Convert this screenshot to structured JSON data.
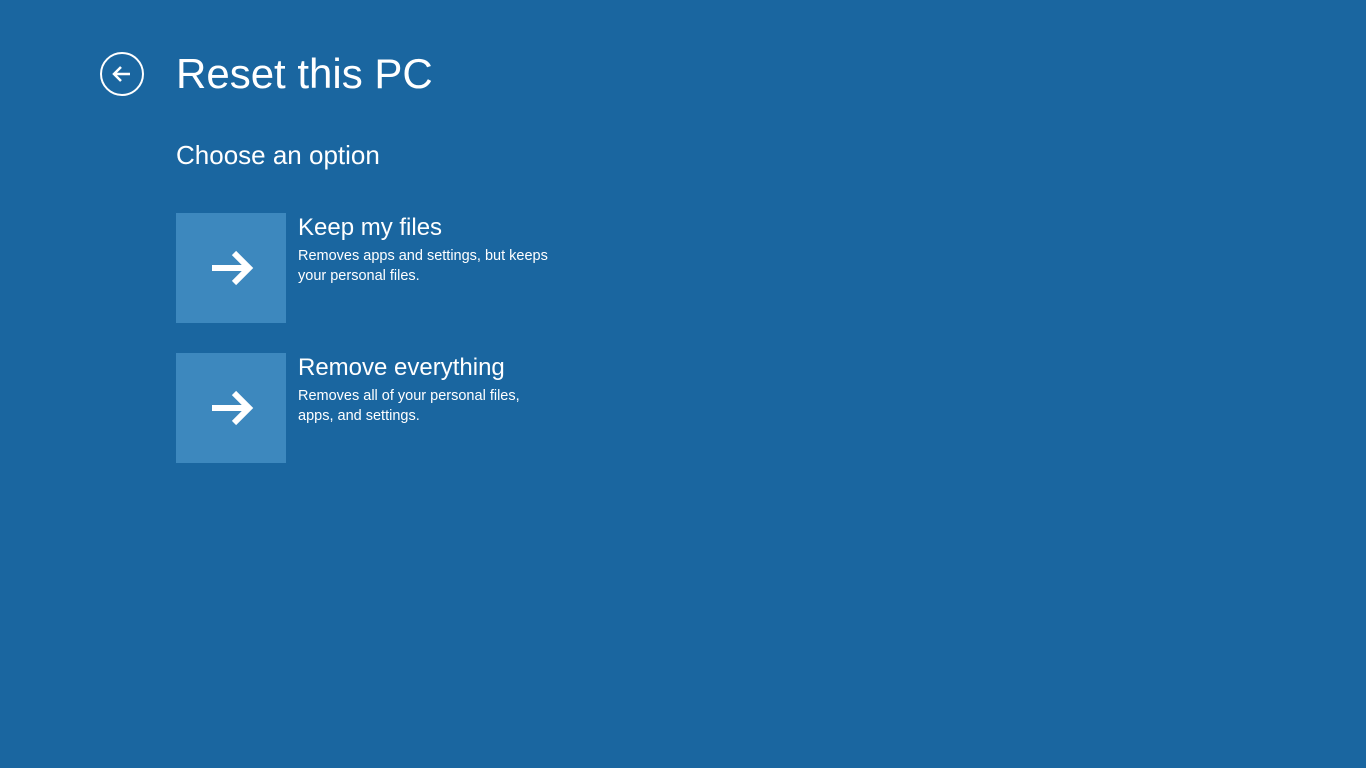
{
  "header": {
    "title": "Reset this PC"
  },
  "content": {
    "subtitle": "Choose an option",
    "options": [
      {
        "title": "Keep my files",
        "description": "Removes apps and settings, but keeps your personal files."
      },
      {
        "title": "Remove everything",
        "description": "Removes all of your personal files, apps, and settings."
      }
    ]
  }
}
